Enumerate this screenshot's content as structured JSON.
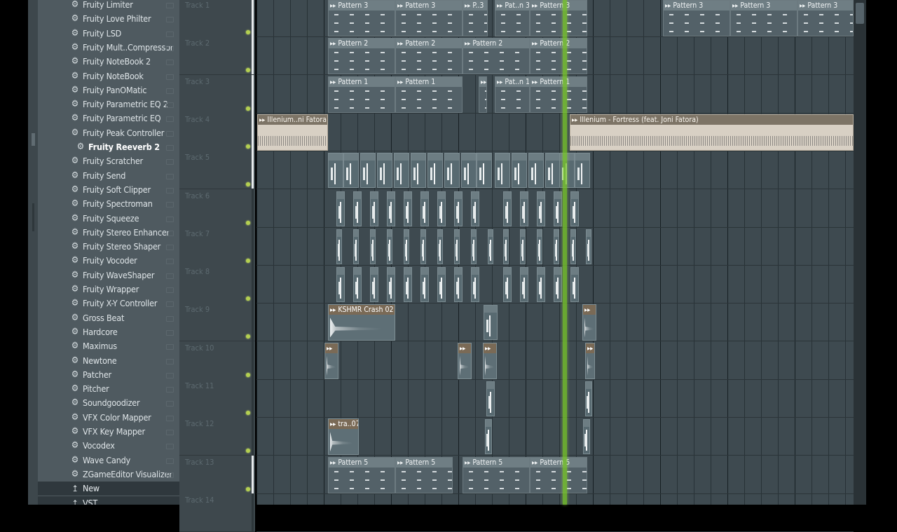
{
  "browser": {
    "items": [
      {
        "label": "Fruity Limiter",
        "type": "plugin"
      },
      {
        "label": "Fruity Love Philter",
        "type": "plugin"
      },
      {
        "label": "Fruity LSD",
        "type": "plugin"
      },
      {
        "label": "Fruity Mult..Compressor",
        "type": "plugin"
      },
      {
        "label": "Fruity NoteBook 2",
        "type": "plugin"
      },
      {
        "label": "Fruity NoteBook",
        "type": "plugin"
      },
      {
        "label": "Fruity PanOMatic",
        "type": "plugin"
      },
      {
        "label": "Fruity Parametric EQ 2",
        "type": "plugin"
      },
      {
        "label": "Fruity Parametric EQ",
        "type": "plugin"
      },
      {
        "label": "Fruity Peak Controller",
        "type": "plugin"
      },
      {
        "label": "Fruity Reeverb 2",
        "type": "plugin",
        "active": true
      },
      {
        "label": "Fruity Scratcher",
        "type": "plugin"
      },
      {
        "label": "Fruity Send",
        "type": "plugin"
      },
      {
        "label": "Fruity Soft Clipper",
        "type": "plugin"
      },
      {
        "label": "Fruity Spectroman",
        "type": "plugin"
      },
      {
        "label": "Fruity Squeeze",
        "type": "plugin"
      },
      {
        "label": "Fruity Stereo Enhancer",
        "type": "plugin"
      },
      {
        "label": "Fruity Stereo Shaper",
        "type": "plugin"
      },
      {
        "label": "Fruity Vocoder",
        "type": "plugin"
      },
      {
        "label": "Fruity WaveShaper",
        "type": "plugin"
      },
      {
        "label": "Fruity Wrapper",
        "type": "plugin"
      },
      {
        "label": "Fruity X-Y Controller",
        "type": "plugin"
      },
      {
        "label": "Gross Beat",
        "type": "plugin"
      },
      {
        "label": "Hardcore",
        "type": "plugin"
      },
      {
        "label": "Maximus",
        "type": "plugin"
      },
      {
        "label": "Newtone",
        "type": "plugin"
      },
      {
        "label": "Patcher",
        "type": "plugin"
      },
      {
        "label": "Pitcher",
        "type": "plugin"
      },
      {
        "label": "Soundgoodizer",
        "type": "plugin"
      },
      {
        "label": "VFX Color Mapper",
        "type": "plugin"
      },
      {
        "label": "VFX Key Mapper",
        "type": "plugin"
      },
      {
        "label": "Vocodex",
        "type": "plugin"
      },
      {
        "label": "Wave Candy",
        "type": "plugin"
      },
      {
        "label": "ZGameEditor Visualizer",
        "type": "plugin"
      },
      {
        "label": "New",
        "type": "folder"
      },
      {
        "label": "VST",
        "type": "folder"
      }
    ]
  },
  "tracks": [
    "Track 1",
    "Track 2",
    "Track 3",
    "Track 4",
    "Track 5",
    "Track 6",
    "Track 7",
    "Track 8",
    "Track 9",
    "Track 10",
    "Track 11",
    "Track 12",
    "Track 13",
    "Track 14"
  ],
  "clips": {
    "pattern3": "Pattern 3",
    "p3short": "P..3",
    "pat3short": "Pat..n 3",
    "pattern2": "Pattern 2",
    "pattern1": "Pattern 1",
    "pat1short": "Pat..n 1",
    "pattern5": "Pattern 5",
    "audio_a": "Illenium..ni Fatora)",
    "audio_b": "Illenium - Fortress (feat. Joni Fatora)",
    "crash": "KSHMR Crash 02",
    "tra07": "tra..07"
  },
  "colors": {
    "panel": "#4f5a60",
    "playlist": "#3e4a50",
    "playhead": "#78c828",
    "audio_clip": "#d8d0c4",
    "pattern_clip": "#536168"
  }
}
